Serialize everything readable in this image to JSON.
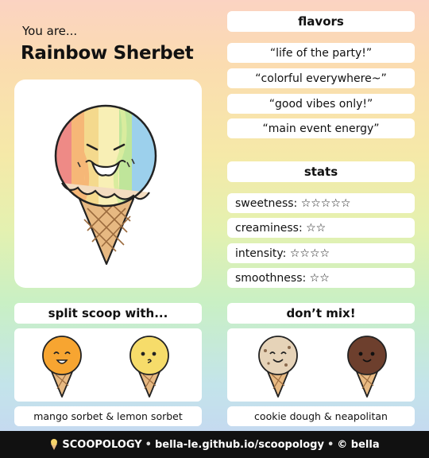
{
  "result": {
    "intro": "You are...",
    "name": "Rainbow Sherbet"
  },
  "flavors": {
    "title": "flavors",
    "quotes": [
      "“life of the party!”",
      "“colorful everywhere~”",
      "“good vibes only!”",
      "“main event energy”"
    ]
  },
  "stats": {
    "title": "stats",
    "items": [
      {
        "label": "sweetness: ☆☆☆☆☆",
        "stars": 5
      },
      {
        "label": "creaminess: ☆☆",
        "stars": 2
      },
      {
        "label": "intensity: ☆☆☆☆",
        "stars": 4
      },
      {
        "label": "smoothness: ☆☆",
        "stars": 2
      }
    ]
  },
  "split": {
    "title": "split scoop with...",
    "caption": "mango sorbet & lemon sorbet"
  },
  "dont_mix": {
    "title": "don’t mix!",
    "caption": "cookie dough & neapolitan"
  },
  "footer": {
    "icon": "ice-cream-icon",
    "brand": "SCOOPOLOGY",
    "url": "bella-le.github.io/scoopology",
    "credit": "© bella"
  },
  "colors": {
    "mango": "#f7a531",
    "lemon": "#f6dc6a",
    "cookie_dough": "#e6d3b8",
    "chocolate": "#6d3f2d",
    "cone": "#e7b982"
  }
}
